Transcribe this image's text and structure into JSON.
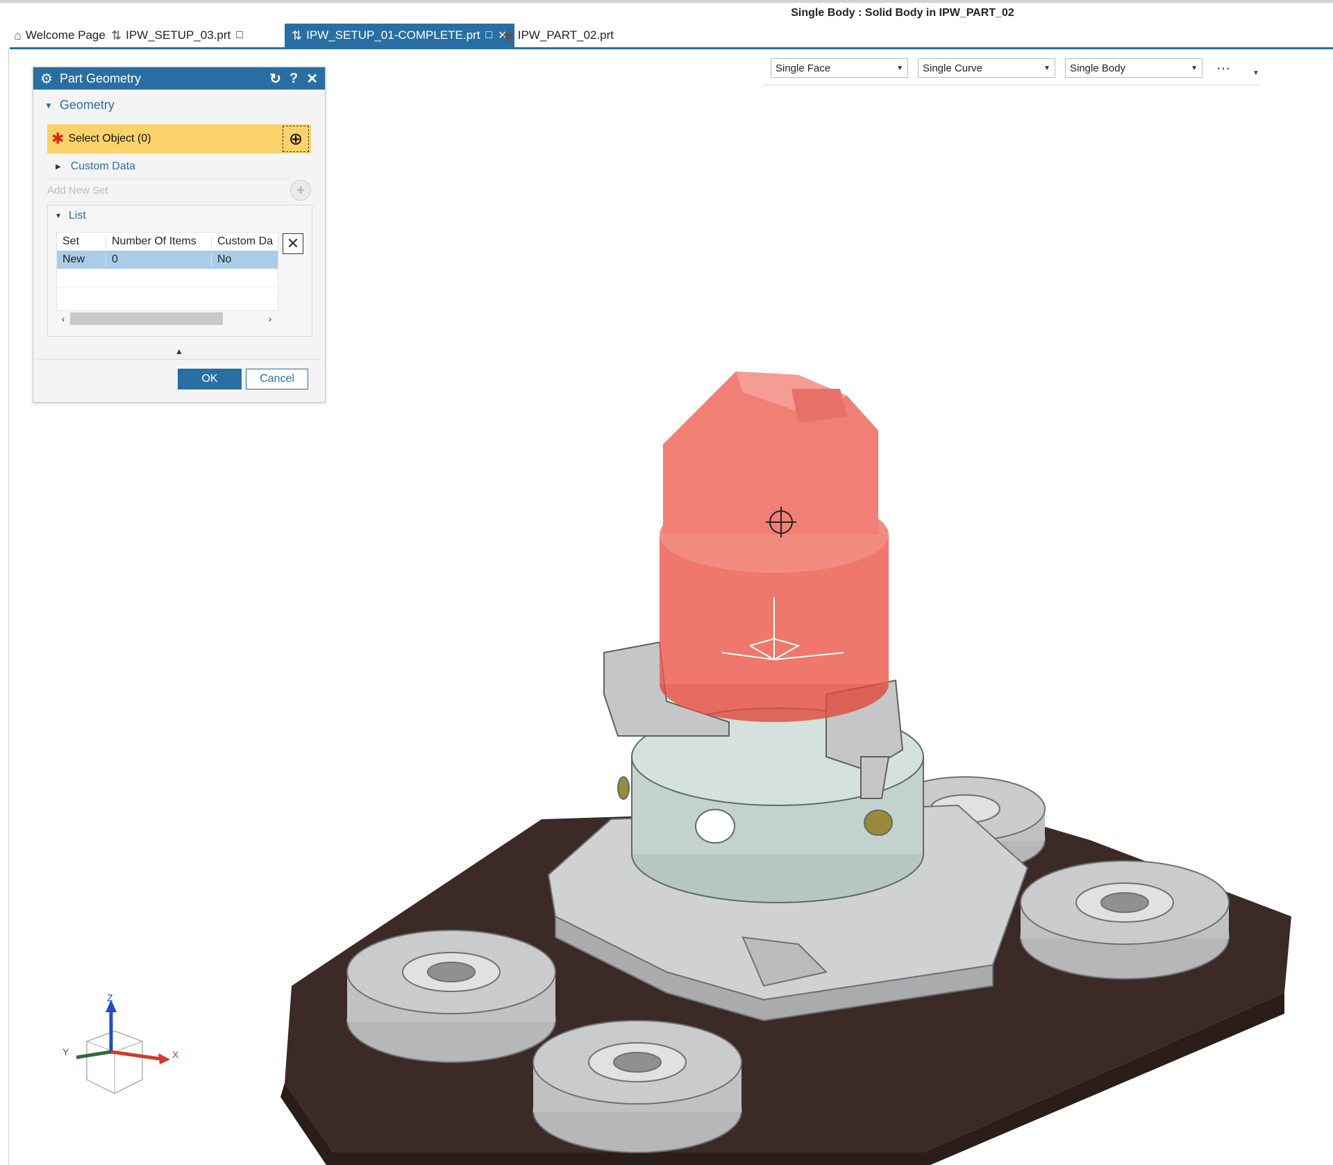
{
  "status": {
    "text": "Single Body : Solid Body in IPW_PART_02"
  },
  "tabs": [
    {
      "label": "Welcome Page",
      "icon": "home-icon"
    },
    {
      "label": "IPW_SETUP_03.prt",
      "icon": "setup-icon"
    },
    {
      "label": "IPW_SETUP_01-COMPLETE.prt",
      "icon": "setup-icon",
      "active": true
    },
    {
      "label": "IPW_PART_02.prt",
      "icon": "part-icon"
    }
  ],
  "filters": {
    "face": "Single Face",
    "curve": "Single Curve",
    "body": "Single Body",
    "more": "⋯"
  },
  "dialog": {
    "title": "Part Geometry",
    "section": "Geometry",
    "select_label": "Select Object (0)",
    "custom_data": "Custom Data",
    "add_new_set": "Add New Set",
    "list_label": "List",
    "columns": [
      "Set",
      "Number Of Items",
      "Custom Da"
    ],
    "rows": [
      {
        "set": "New",
        "items": "0",
        "custom": "No"
      }
    ],
    "ok": "OK",
    "cancel": "Cancel"
  },
  "viewport": {
    "highlight_color": "#ec5a4c",
    "plate_color": "#3b2a26",
    "triad": {
      "x": "X",
      "y": "Y",
      "z": "Z"
    },
    "wcs_label": {
      "x": "X",
      "y": "Y",
      "z": "Z"
    }
  }
}
